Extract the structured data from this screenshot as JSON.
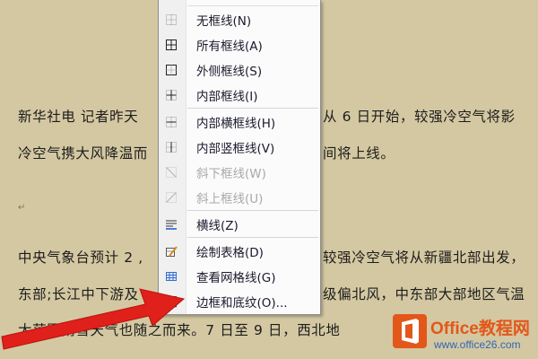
{
  "document": {
    "lines": [
      "新华社电  记者昨天",
      "冷空气携大风降温而",
      "中央气象台预计 2 ,",
      "东部;长江中下游及",
      "大范围雨雪天气也随之而来。7 日至 9 日，西北地"
    ],
    "right_lines": [
      "从 6 日开始，较强冷空气将影",
      "间将上线。",
      "较强冷空气将从新疆北部出发，",
      "级偏北风，中东部大部地区气温"
    ],
    "paragraph_mark": "↵"
  },
  "border_menu": {
    "items": [
      {
        "label": "无框线(N)",
        "icon": "no-border-icon",
        "disabled": false
      },
      {
        "label": "所有框线(A)",
        "icon": "all-borders-icon",
        "disabled": false
      },
      {
        "label": "外侧框线(S)",
        "icon": "outside-borders-icon",
        "disabled": false
      },
      {
        "label": "内部框线(I)",
        "icon": "inside-borders-icon",
        "disabled": false
      },
      {
        "label": "内部横框线(H)",
        "icon": "inside-horizontal-border-icon",
        "disabled": false
      },
      {
        "label": "内部竖框线(V)",
        "icon": "inside-vertical-border-icon",
        "disabled": false
      },
      {
        "label": "斜下框线(W)",
        "icon": "diagonal-down-border-icon",
        "disabled": true
      },
      {
        "label": "斜上框线(U)",
        "icon": "diagonal-up-border-icon",
        "disabled": true
      },
      {
        "label": "横线(Z)",
        "icon": "horizontal-line-icon",
        "disabled": false
      },
      {
        "label": "绘制表格(D)",
        "icon": "draw-table-icon",
        "disabled": false
      },
      {
        "label": "查看网格线(G)",
        "icon": "view-gridlines-icon",
        "disabled": false
      },
      {
        "label": "边框和底纹(O)...",
        "icon": "borders-shading-icon",
        "disabled": false
      }
    ]
  },
  "watermark": {
    "title": "Office教程网",
    "url": "www.office26.com"
  },
  "colors": {
    "page_background": "#d4c8a2",
    "arrow": "#e0201a",
    "watermark_orange": "#e2571a"
  }
}
